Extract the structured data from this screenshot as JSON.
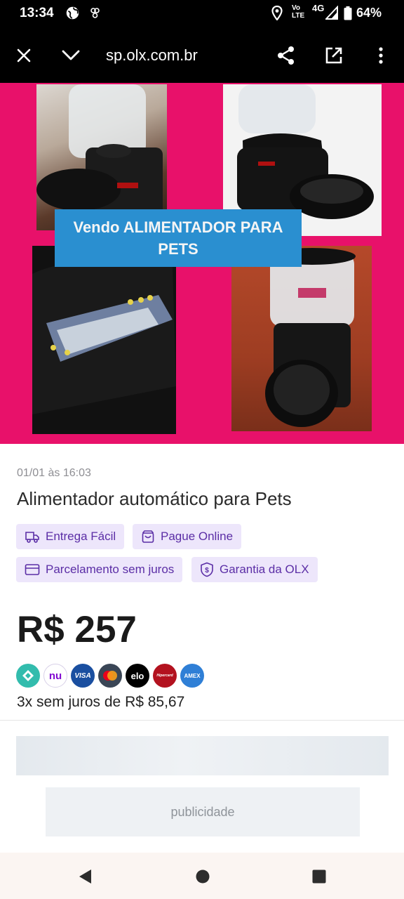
{
  "status_bar": {
    "time": "13:34",
    "network": "4G",
    "volte": "Vo LTE",
    "battery": "64%"
  },
  "browser": {
    "url": "sp.olx.com.br",
    "icons": [
      "close-icon",
      "chevron-down-icon",
      "share-icon",
      "open-external-icon",
      "more-vert-icon"
    ]
  },
  "hero": {
    "banner_line1": "Vendo ALIMENTADOR PARA",
    "banner_line2": "PETS",
    "background": "#e8116a"
  },
  "listing": {
    "date": "01/01 às 16:03",
    "title": "Alimentador automático para Pets",
    "tags": [
      {
        "label": "Entrega Fácil",
        "icon": "delivery-icon"
      },
      {
        "label": "Pague Online",
        "icon": "bag-icon"
      },
      {
        "label": "Parcelamento sem juros",
        "icon": "card-icon"
      },
      {
        "label": "Garantia da OLX",
        "icon": "shield-dollar-icon"
      }
    ],
    "price": "R$ 257",
    "payment_methods": [
      {
        "name": "pix",
        "label": "",
        "color": "#32bcad"
      },
      {
        "name": "nubank",
        "label": "nu",
        "color": "#ffffff"
      },
      {
        "name": "visa",
        "label": "VISA",
        "color": "#1a4fa0"
      },
      {
        "name": "mastercard",
        "label": "",
        "color": "#3a4656"
      },
      {
        "name": "elo",
        "label": "elo",
        "color": "#000000"
      },
      {
        "name": "hipercard",
        "label": "Hipercard",
        "color": "#b3121f"
      },
      {
        "name": "amex",
        "label": "AMEX",
        "color": "#2f7fd6"
      }
    ],
    "installments": "3x sem juros de R$ 85,67"
  },
  "ad": {
    "label": "publicidade"
  },
  "colors": {
    "tag_bg": "#ede6fb",
    "tag_text": "#5b2ea6"
  }
}
